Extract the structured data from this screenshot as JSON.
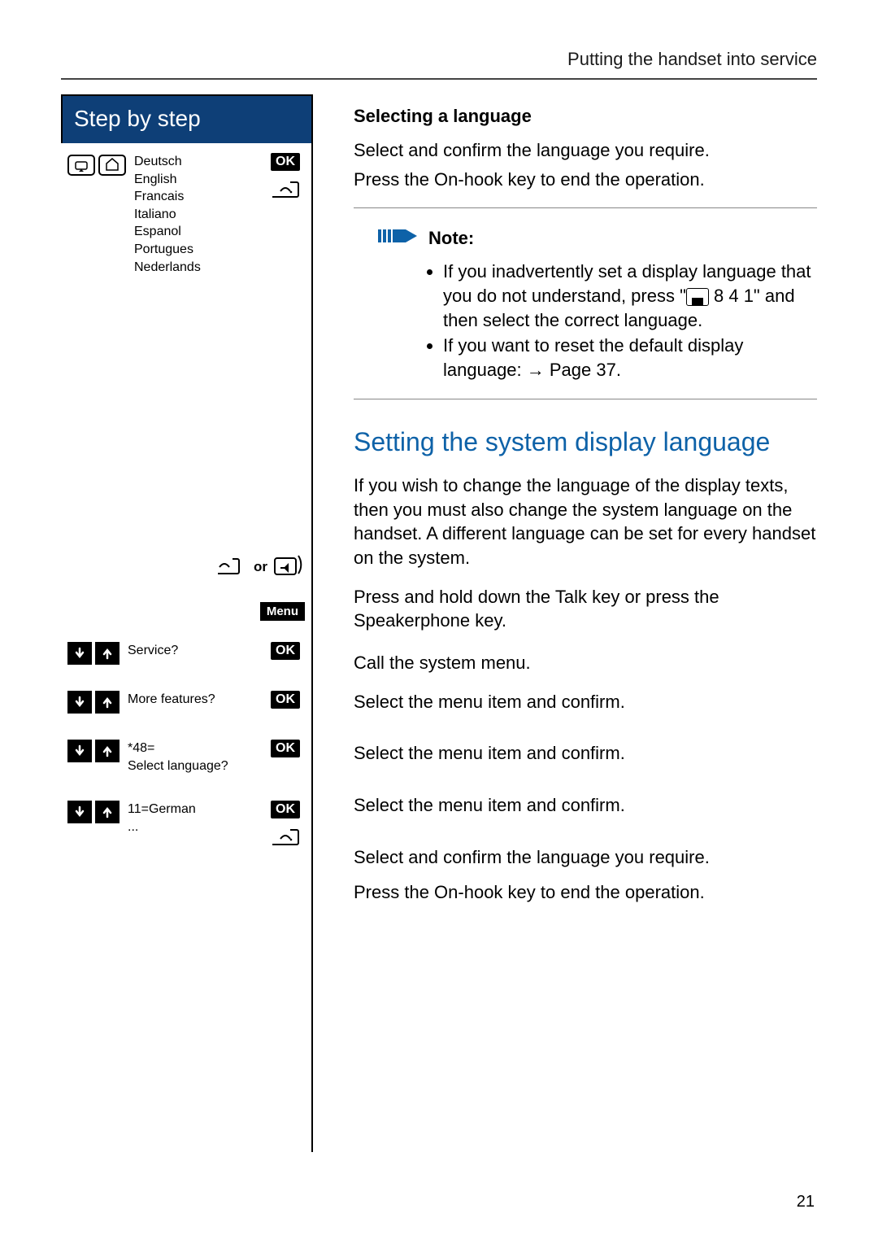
{
  "header": {
    "running": "Putting the handset into service"
  },
  "sidebar": {
    "title": "Step by step",
    "languages": [
      "Deutsch",
      "English",
      "Francais",
      "Italiano",
      "Espanol",
      "Portugues",
      "Nederlands"
    ],
    "ok": "OK",
    "menu": "Menu",
    "or": "or",
    "rows": {
      "service": "Service?",
      "more": "More features?",
      "code1": "*48=",
      "code2": "Select language?",
      "lang1": "11=German",
      "lang2": "..."
    }
  },
  "content": {
    "s1_title": "Selecting a language",
    "s1_p1": "Select and confirm the language you require.",
    "s1_p2": "Press the On-hook key to end the operation.",
    "note_label": "Note:",
    "note_li1_a": "If you inadvertently set a display language that you do not understand, press \"",
    "note_li1_code": " 8 4 1\"",
    "note_li1_b": "and then select the correct language.",
    "note_li2": "If you want to reset the default display language: → Page 37.",
    "s2_title": "Setting the system display language",
    "s2_p1": "If you wish to change the language of the display texts, then you must also change the system language on the handset. A different language can be set for every handset on the system.",
    "s2_p2": "Press and hold down the Talk key or press the Speakerphone key.",
    "s2_p3": "Call the system menu.",
    "s2_p4": "Select the menu item and confirm.",
    "s2_p5": "Select the menu item and confirm.",
    "s2_p6": "Select the menu item and confirm.",
    "s2_p7": "Select and confirm the language you require.",
    "s2_p8": "Press the On-hook key to end the operation."
  },
  "page_number": "21"
}
